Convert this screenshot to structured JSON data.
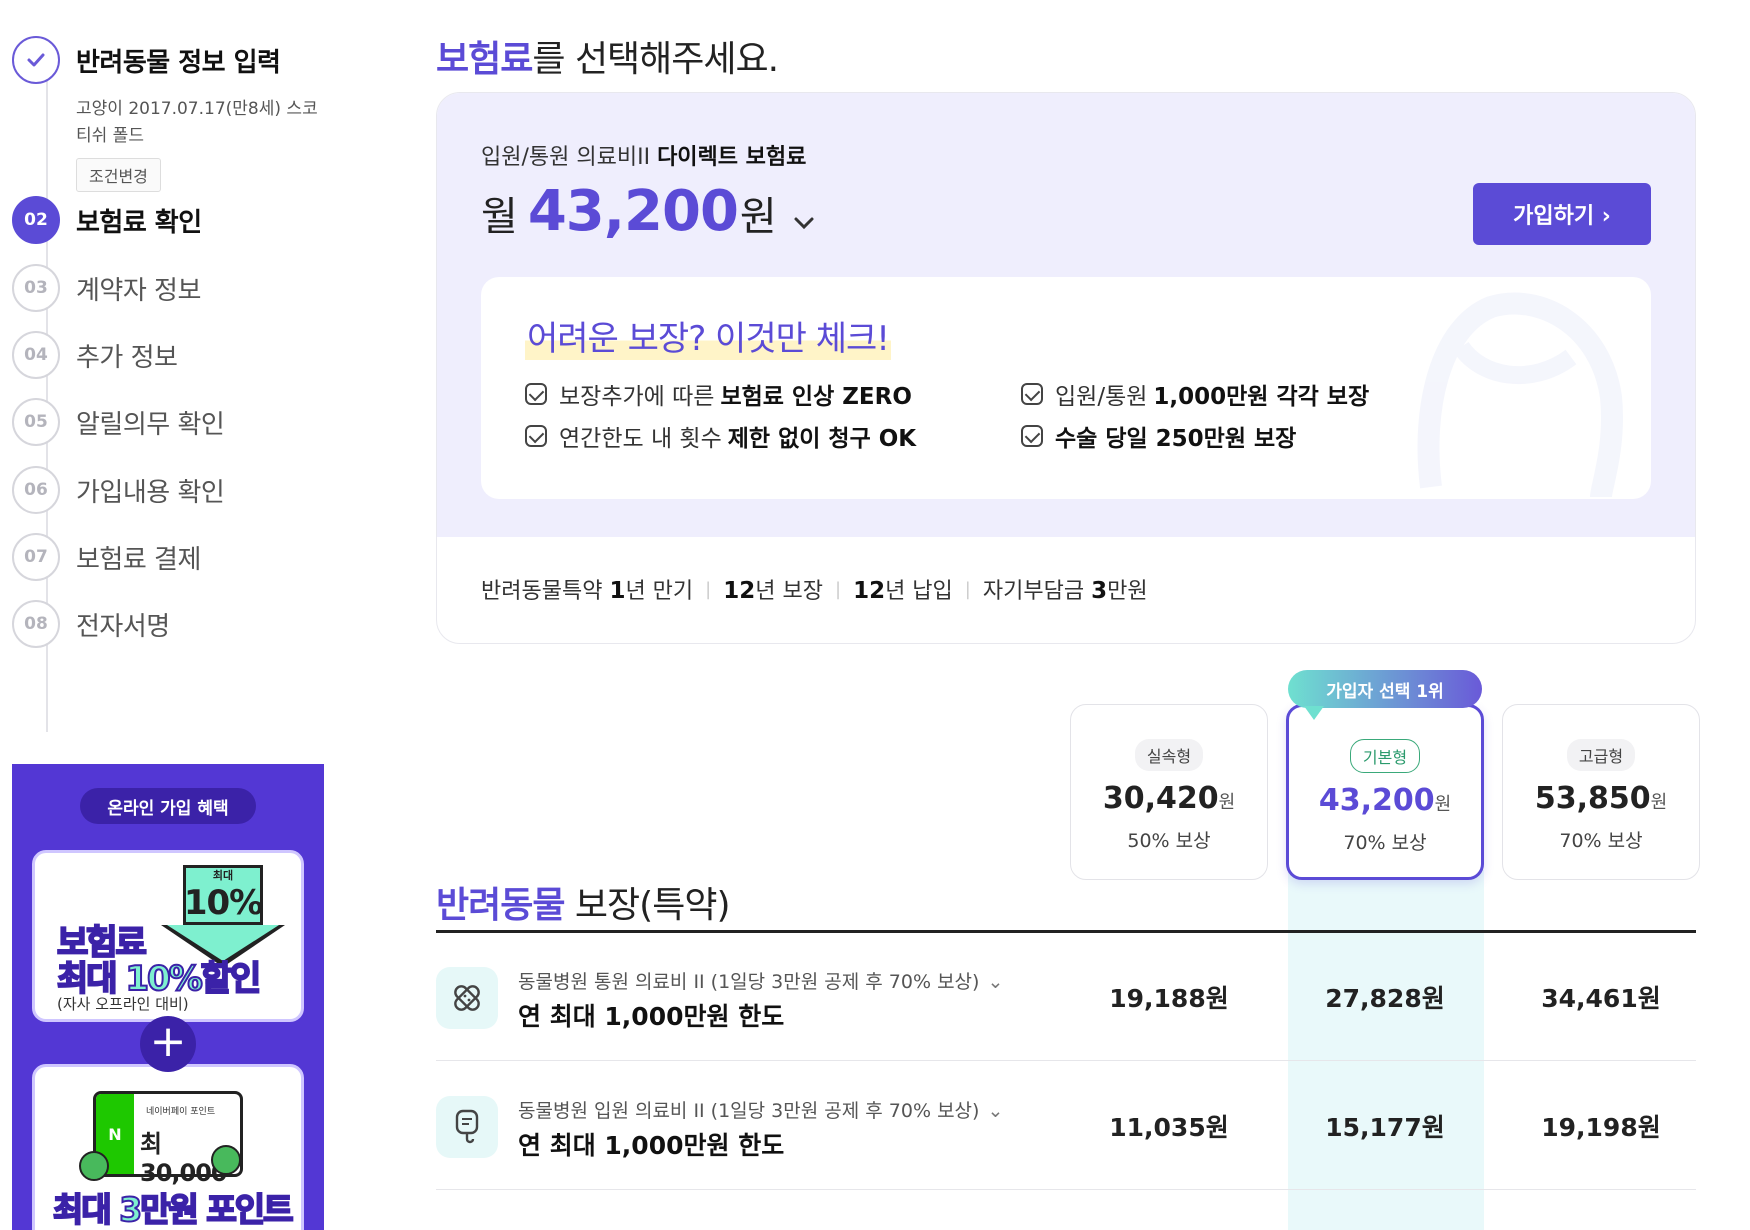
{
  "steps": [
    {
      "num": "✓",
      "label": "반려동물 정보 입력",
      "desc": "고양이 2017.07.17(만8세) 스코티쉬 폴드",
      "button": "조건변경"
    },
    {
      "num": "02",
      "label": "보험료 확인"
    },
    {
      "num": "03",
      "label": "계약자 정보"
    },
    {
      "num": "04",
      "label": "추가 정보"
    },
    {
      "num": "05",
      "label": "알릴의무 확인"
    },
    {
      "num": "06",
      "label": "가입내용 확인"
    },
    {
      "num": "07",
      "label": "보험료 결제"
    },
    {
      "num": "08",
      "label": "전자서명"
    }
  ],
  "promo": {
    "pill": "온라인 가입 혜택",
    "arrow_small": "최대",
    "arrow_big": "10%",
    "line1": "보험료",
    "line2": "최대 10%할인",
    "small": "(자사 오프라인 대비)",
    "plus": "+",
    "npay_label": "네이버페이 포인트",
    "npay_value": "최30,000",
    "npay_n": "N",
    "line3": "최대 3만원 포인트"
  },
  "title": {
    "accent": "보험료",
    "rest": "를 선택해주세요."
  },
  "plan": {
    "sub_light": "입원/통원 의료비II ",
    "sub_bold": "다이렉트 보험료",
    "price_pre": "월",
    "price": "43,200",
    "price_unit": "원",
    "caret": "⌄",
    "join_label": "가입하기 ›",
    "check_title": "어려운 보장? 이것만 체크!",
    "checks": [
      {
        "light": "보장추가에 따른",
        "bold": "보험료 인상 ZERO"
      },
      {
        "light": "입원/통원",
        "bold": "1,000만원 각각 보장"
      },
      {
        "light": "연간한도 내 횟수",
        "bold": "제한 없이 청구 OK"
      },
      {
        "light": "",
        "bold": "수술 당일 250만원 보장"
      }
    ],
    "terms": [
      {
        "pre": "반려동물특약 ",
        "num": "1",
        "post": "년 만기"
      },
      {
        "pre": "",
        "num": "12",
        "post": "년 보장"
      },
      {
        "pre": "",
        "num": "12",
        "post": "년 납입"
      },
      {
        "pre": "자기부담금 ",
        "num": "3",
        "post": "만원"
      }
    ]
  },
  "rank_badge": "가입자 선택 1위",
  "plans": [
    {
      "tag": "실속형",
      "price": "30,420",
      "unit": "원",
      "pct": "50% 보상"
    },
    {
      "tag": "기본형",
      "price": "43,200",
      "unit": "원",
      "pct": "70% 보상"
    },
    {
      "tag": "고급형",
      "price": "53,850",
      "unit": "원",
      "pct": "70% 보상"
    }
  ],
  "coverage": {
    "title_accent": "반려동물",
    "title_rest": " 보장(특약)",
    "rows": [
      {
        "icon": "bandage-icon",
        "name": "동물병원 통원 의료비 II (1일당 3만원 공제 후 70% 보상)",
        "caret": "⌄",
        "limit": "연 최대 1,000만원 한도",
        "values": [
          "19,188원",
          "27,828원",
          "34,461원"
        ]
      },
      {
        "icon": "iv-drip-icon",
        "name": "동물병원 입원 의료비 II (1일당 3만원 공제 후 70% 보상)",
        "caret": "⌄",
        "limit": "연 최대 1,000만원 한도",
        "values": [
          "11,035원",
          "15,177원",
          "19,198원"
        ]
      }
    ]
  },
  "colors": {
    "accent": "#5b4bd6",
    "mint": "#7ef0cf",
    "promo_bg": "#5337d4"
  }
}
